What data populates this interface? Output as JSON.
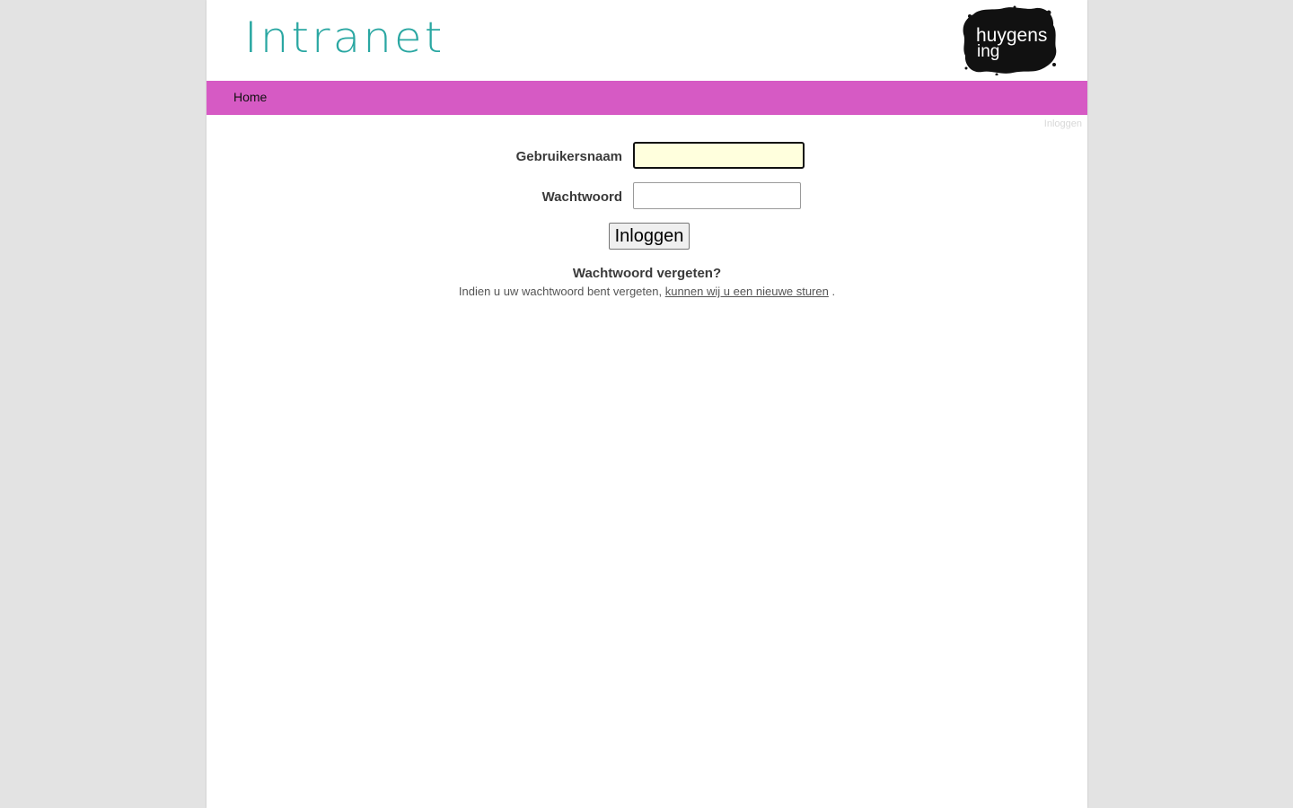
{
  "header": {
    "title": "Intranet",
    "logo_text_line1": "huygens",
    "logo_text_line2": "ing"
  },
  "nav": {
    "home_label": "Home"
  },
  "top_login_link": "Inloggen",
  "form": {
    "username_label": "Gebruikersnaam",
    "username_value": "",
    "password_label": "Wachtwoord",
    "password_value": "",
    "submit_label": "Inloggen"
  },
  "forgot": {
    "heading": "Wachtwoord vergeten?",
    "text_before": "Indien u uw wachtwoord bent vergeten,",
    "link_text": "kunnen wij u een nieuwe sturen",
    "text_after": "."
  },
  "colors": {
    "background": "#e3e3e3",
    "navbar": "#d65ac4",
    "title": "#2aa7a2",
    "focused_input_bg": "#ffffdd"
  }
}
